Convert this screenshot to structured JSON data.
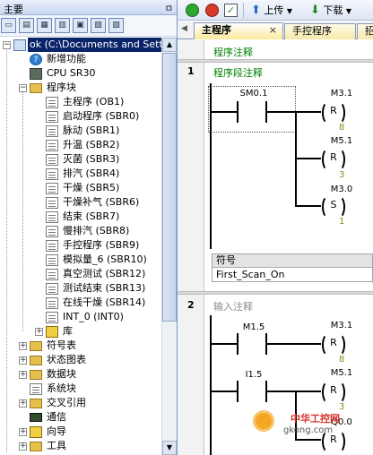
{
  "left_panel": {
    "title": "主要",
    "pin": "ㅁ",
    "tree": [
      {
        "label": "ok (C:\\Documents and Settings",
        "icon": "project-icon",
        "selected": true
      },
      {
        "label": "新增功能",
        "icon": "help-icon"
      },
      {
        "label": "CPU SR30",
        "icon": "cpu-icon"
      },
      {
        "label": "程序块",
        "icon": "folder-icon"
      },
      {
        "label": "主程序 (OB1)",
        "icon": "program-block-icon"
      },
      {
        "label": "启动程序 (SBR0)",
        "icon": "program-block-icon"
      },
      {
        "label": "脉动 (SBR1)",
        "icon": "program-block-icon"
      },
      {
        "label": "升温 (SBR2)",
        "icon": "program-block-icon"
      },
      {
        "label": "灭菌 (SBR3)",
        "icon": "program-block-icon"
      },
      {
        "label": "排汽 (SBR4)",
        "icon": "program-block-icon"
      },
      {
        "label": "干燥 (SBR5)",
        "icon": "program-block-icon"
      },
      {
        "label": "干燥补气 (SBR6)",
        "icon": "program-block-icon"
      },
      {
        "label": "结束 (SBR7)",
        "icon": "program-block-icon"
      },
      {
        "label": "慢排汽 (SBR8)",
        "icon": "program-block-icon"
      },
      {
        "label": "手控程序 (SBR9)",
        "icon": "program-block-icon"
      },
      {
        "label": "模拟量_6 (SBR10)",
        "icon": "program-block-icon"
      },
      {
        "label": "真空测试 (SBR12)",
        "icon": "program-block-icon"
      },
      {
        "label": "测试结束 (SBR13)",
        "icon": "program-block-icon"
      },
      {
        "label": "在线干燥 (SBR14)",
        "icon": "program-block-icon"
      },
      {
        "label": "INT_0 (INT0)",
        "icon": "program-block-icon"
      },
      {
        "label": "库",
        "icon": "library-icon"
      },
      {
        "label": "符号表",
        "icon": "folder-icon"
      },
      {
        "label": "状态图表",
        "icon": "folder-icon"
      },
      {
        "label": "数据块",
        "icon": "folder-icon"
      },
      {
        "label": "系统块",
        "icon": "system-block-icon"
      },
      {
        "label": "交叉引用",
        "icon": "folder-icon"
      },
      {
        "label": "通信",
        "icon": "communication-icon"
      },
      {
        "label": "向导",
        "icon": "wizard-icon"
      },
      {
        "label": "工具",
        "icon": "folder-icon"
      }
    ]
  },
  "toolbar": {
    "upload_label": "上传",
    "download_label": "下载"
  },
  "tabs": [
    "主程序",
    "手控程序",
    "招"
  ],
  "tab_close": "×",
  "editor": {
    "program_comment": "程序注释",
    "networks": [
      {
        "number": "1",
        "comment": "程序段注释",
        "contact": "SM0.1",
        "coils": [
          {
            "address": "M3.1",
            "type": "R",
            "count": "8"
          },
          {
            "address": "M5.1",
            "type": "R",
            "count": "3"
          },
          {
            "address": "M3.0",
            "type": "S",
            "count": "1"
          }
        ],
        "symbol_header": "符号",
        "symbol_value": "First_Scan_On"
      },
      {
        "number": "2",
        "comment": "输入注释",
        "contacts": [
          "M1.5",
          "I1.5"
        ],
        "coils": [
          {
            "address": "M3.1",
            "type": "R",
            "count": "8"
          },
          {
            "address": "M5.1",
            "type": "R",
            "count": "3"
          },
          {
            "address": "Q0.0",
            "type": "R",
            "count": ""
          }
        ]
      }
    ]
  },
  "watermark": {
    "line1": "中华工控网",
    "line2": "gkong.com"
  },
  "colors": {
    "selection": "#0a246a",
    "network_comment": "#008000",
    "tab_active": "#fbe99d"
  }
}
